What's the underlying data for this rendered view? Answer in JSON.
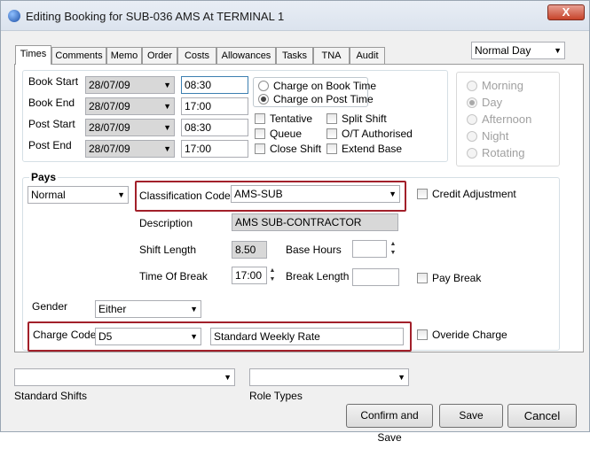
{
  "window": {
    "title": "Editing Booking for SUB-036 AMS At TERMINAL 1",
    "close_glyph": "X"
  },
  "tabs": [
    "Times",
    "Comments",
    "Memo",
    "Order",
    "Costs",
    "Allowances",
    "Tasks",
    "TNA",
    "Audit"
  ],
  "day_type_select": "Normal Day",
  "times": {
    "book_start_label": "Book Start",
    "book_start_date": "28/07/09",
    "book_start_time": "08:30",
    "book_end_label": "Book End",
    "book_end_date": "28/07/09",
    "book_end_time": "17:00",
    "post_start_label": "Post Start",
    "post_start_date": "28/07/09",
    "post_start_time": "08:30",
    "post_end_label": "Post End",
    "post_end_date": "28/07/09",
    "post_end_time": "17:00"
  },
  "charge_on": {
    "book_time": "Charge on Book Time",
    "post_time": "Charge on Post Time",
    "selected": "post_time"
  },
  "flags": {
    "tentative": "Tentative",
    "split_shift": "Split Shift",
    "queue": "Queue",
    "ot_authorised": "O/T Authorised",
    "close_shift": "Close Shift",
    "extend_base": "Extend Base"
  },
  "shift_period": {
    "options": [
      "Morning",
      "Day",
      "Afternoon",
      "Night",
      "Rotating"
    ],
    "selected": "Day"
  },
  "pays": {
    "heading": "Pays",
    "pay_type": "Normal",
    "classification_label": "Classification Code",
    "classification_value": "AMS-SUB",
    "credit_adjustment": "Credit Adjustment",
    "description_label": "Description",
    "description_value": "AMS SUB-CONTRACTOR",
    "shift_length_label": "Shift Length",
    "shift_length_value": "8.50",
    "base_hours_label": "Base Hours",
    "base_hours_value": "",
    "time_of_break_label": "Time Of Break",
    "time_of_break_value": "17:00",
    "break_length_label": "Break Length",
    "break_length_value": "",
    "pay_break": "Pay Break",
    "gender_label": "Gender",
    "gender_value": "Either",
    "charge_code_label": "Charge Code",
    "charge_code_value": "D5",
    "charge_desc_value": "Standard Weekly Rate",
    "override_charge": "Overide Charge"
  },
  "footer": {
    "standard_shifts_label": "Standard Shifts",
    "standard_shifts_value": "",
    "role_types_label": "Role Types",
    "role_types_value": "",
    "confirm_save": "Confirm and Save",
    "save": "Save",
    "cancel": "Cancel"
  },
  "colors": {
    "highlight_border": "#a2202a",
    "disabled_text": "#a0a0a0"
  }
}
